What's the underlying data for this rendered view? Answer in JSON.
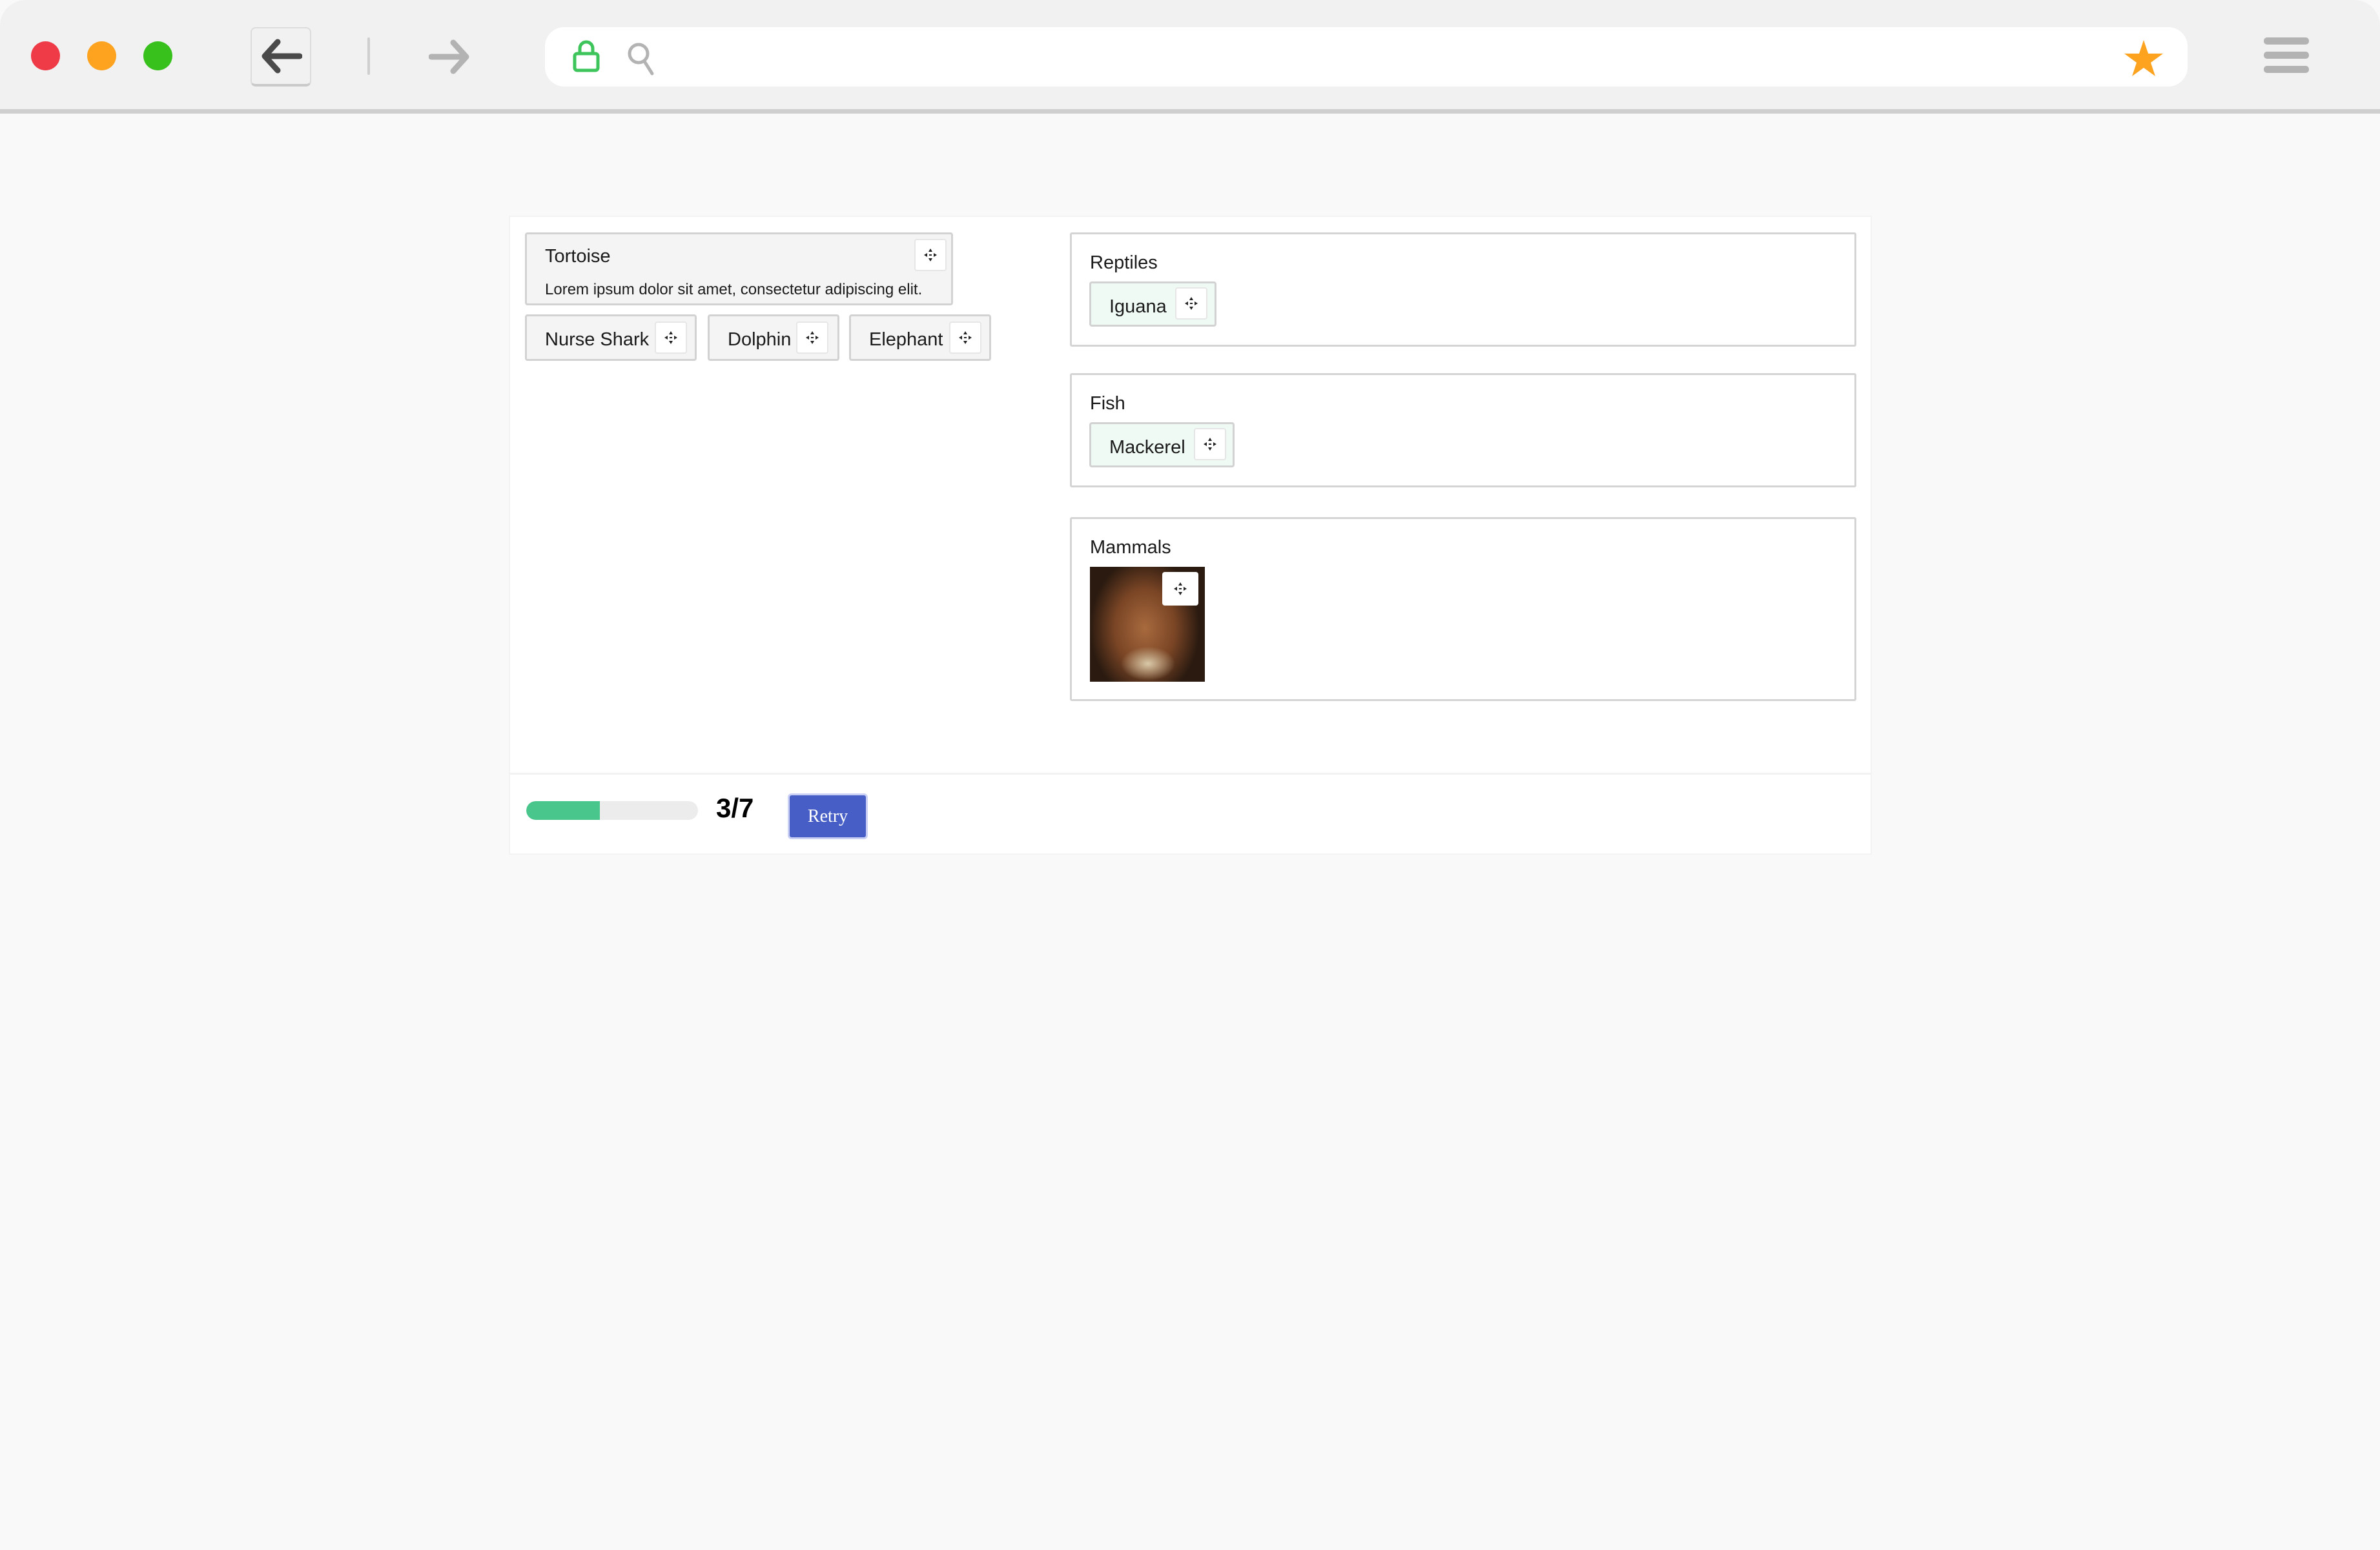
{
  "browser": {
    "window_controls": [
      "close",
      "minimize",
      "maximize"
    ],
    "back_icon": "arrow-left-icon",
    "forward_icon": "arrow-right-icon",
    "url": "",
    "lock_icon": "lock-icon",
    "search_icon": "search-icon",
    "bookmark_icon": "star-icon",
    "menu_icon": "hamburger-menu-icon",
    "colors": {
      "close": "#ee3b47",
      "minimize": "#fda31f",
      "maximize": "#38c11d",
      "lock": "#3dc45a",
      "star": "#fda31f"
    }
  },
  "source_items": [
    {
      "label": "Tortoise",
      "description": "Lorem ipsum dolor sit amet, consectetur adipiscing elit.",
      "handle_icon": "move-icon"
    },
    {
      "label": "Nurse Shark",
      "handle_icon": "move-icon"
    },
    {
      "label": "Dolphin",
      "handle_icon": "move-icon"
    },
    {
      "label": "Elephant",
      "handle_icon": "move-icon"
    }
  ],
  "drop_zones": [
    {
      "title": "Reptiles",
      "items": [
        {
          "label": "Iguana",
          "handle_icon": "move-icon"
        }
      ]
    },
    {
      "title": "Fish",
      "items": [
        {
          "label": "Mackerel",
          "handle_icon": "move-icon"
        }
      ]
    },
    {
      "title": "Mammals",
      "items": [
        {
          "type": "image",
          "alt": "Photo of a smiling bearded man",
          "handle_icon": "move-icon"
        }
      ]
    }
  ],
  "footer": {
    "progress": {
      "correct": 3,
      "total": 7,
      "fraction": 0.4286,
      "color": "#49c68b"
    },
    "score_text": "3/7",
    "retry_label": "Retry",
    "retry_color": "#465ec6"
  }
}
